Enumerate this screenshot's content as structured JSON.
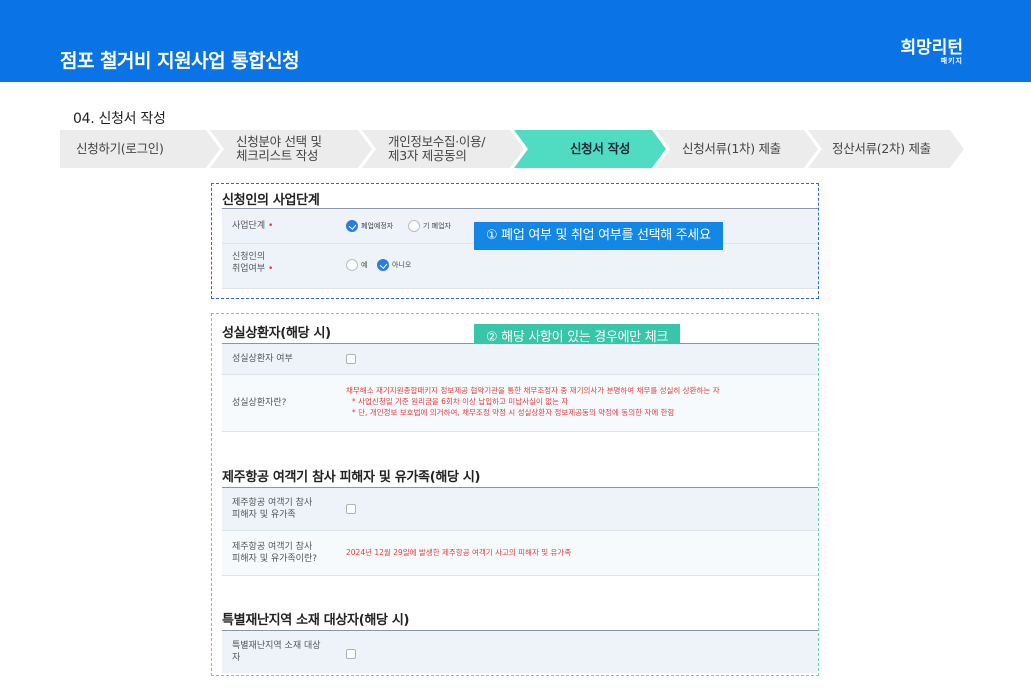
{
  "header": {
    "title": "점포 철거비 지원사업 통합신청",
    "logo_text": "희망리턴",
    "logo_sub": "패키지"
  },
  "section_label": "04. 신청서 작성",
  "steps": [
    {
      "line1": "신청하기(로그인)",
      "line2": ""
    },
    {
      "line1": "신청분야 선택 및",
      "line2": "체크리스트 작성"
    },
    {
      "line1": "개인정보수집·이용/",
      "line2": "제3자 제공동의"
    },
    {
      "line1": "신청서 작성",
      "line2": ""
    },
    {
      "line1": "신청서류(1차) 제출",
      "line2": ""
    },
    {
      "line1": "정산서류(2차) 제출",
      "line2": ""
    }
  ],
  "business_stage": {
    "title": "신청인의 사업단계",
    "stage_label": "사업단계",
    "stage_options": [
      "폐업예정자",
      "기 폐업자"
    ],
    "employ_label_1": "신청인의",
    "employ_label_2": "취업여부",
    "employ_options": [
      "예",
      "아니오"
    ],
    "required_mark": "•"
  },
  "callout1": "① 폐업 여부 및 취업 여부를 선택해 주세요",
  "callout2": "② 해당 사항이 있는 경우에만 체크",
  "sincere": {
    "title": "성실상환자(해당 시)",
    "check_label": "성실상환자 여부",
    "what_label": "성실상환자란?",
    "desc1": "채무해소 재기지원종합패키지 정보제공 협약기관을 통한 채무조정자 중 재기의사가 분명하여 채무를 성실히 상환하는 자",
    "desc2": "* 사업신청일 기준 원리금을 6회차 이상 납입하고 미납사실이 없는 자",
    "desc3": "* 단, 개인정보 보호법에 의거하여, 채무조정 약정 시 성실상환자 정보제공동의 약정에 동의한 자에 한함"
  },
  "jeju": {
    "title": "제주항공 여객기 참사 피해자 및 유가족(해당 시)",
    "check_label_1": "제주항공 여객기 참사",
    "check_label_2": "피해자 및 유가족",
    "what_label_1": "제주항공 여객기 참사",
    "what_label_2": "피해자 및 유가족이란?",
    "desc": "2024년 12월 29일에 발생한 제주항공 여객기 사고의 피해자 및 유가족"
  },
  "disaster": {
    "title": "특별재난지역 소재 대상자(해당 시)",
    "check_label_1": "특별재난지역 소재 대상",
    "check_label_2": "자"
  },
  "colors": {
    "header": "#0a74e6",
    "active_step": "#4fdcc2",
    "callout_blue": "#1387e6",
    "callout_green": "#37c6a8",
    "desc_red": "#e33c3c"
  }
}
